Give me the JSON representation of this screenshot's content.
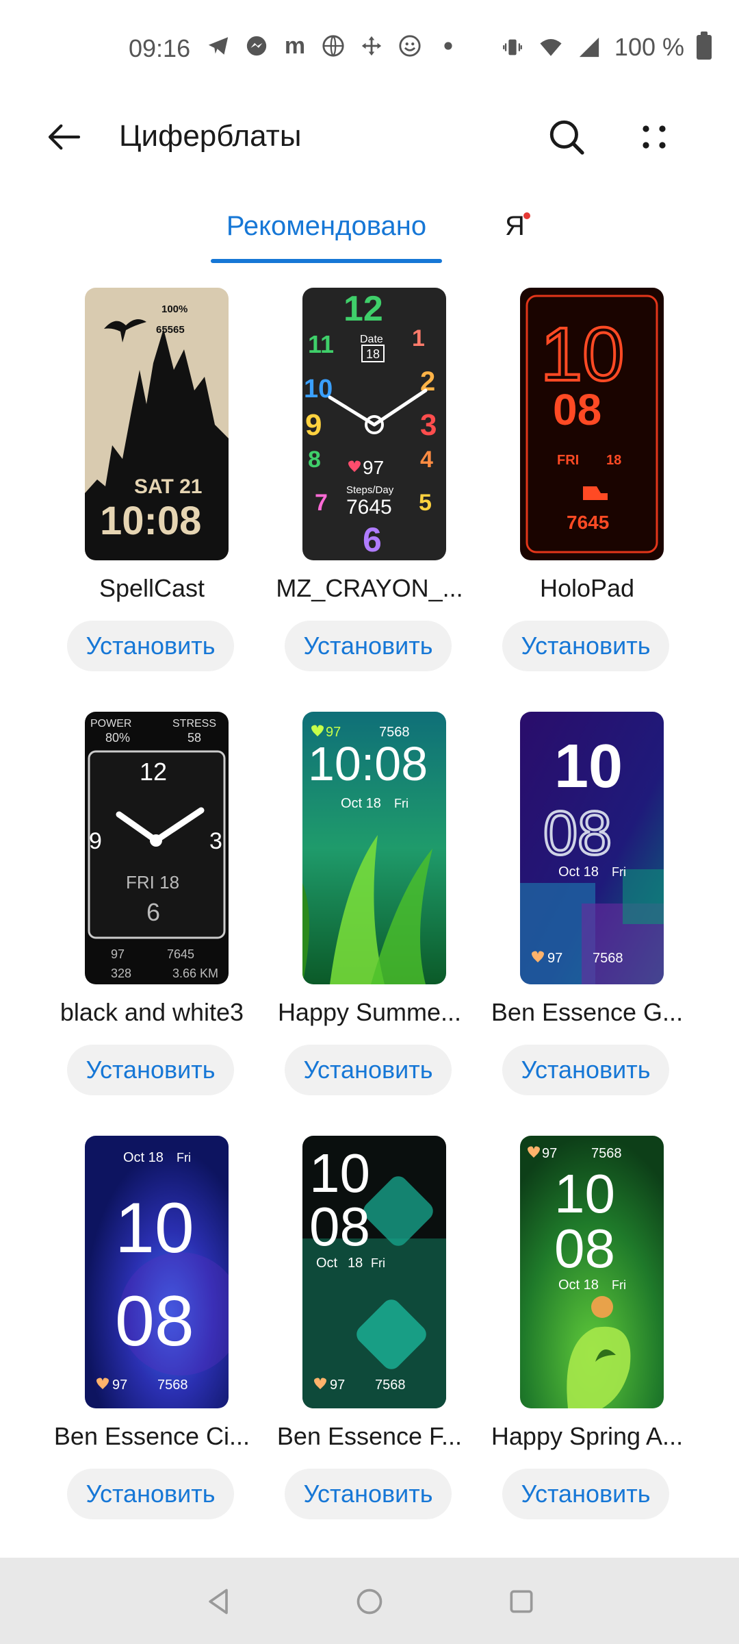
{
  "status_bar": {
    "time": "09:16",
    "battery": "100 %",
    "icons": [
      "telegram-icon",
      "messenger-icon",
      "m-icon",
      "globe-icon",
      "move-icon",
      "emoji-icon",
      "dot-icon"
    ]
  },
  "app_bar": {
    "title": "Циферблаты"
  },
  "tabs": {
    "recommended": "Рекомендовано",
    "me": "Я"
  },
  "accent_color": "#1677d6",
  "install_label": "Установить",
  "faces": [
    {
      "name": "SpellCast",
      "texts": [
        "100%",
        "65565",
        "SAT 21",
        "10:08"
      ]
    },
    {
      "name": "MZ_CRAYON_...",
      "texts": [
        "12",
        "Date",
        "18",
        "11",
        "1",
        "10",
        "2",
        "9",
        "3",
        "8",
        "4",
        "97",
        "Steps/Day",
        "7645",
        "7",
        "5",
        "6"
      ]
    },
    {
      "name": "HoloPad",
      "texts": [
        "10",
        "08",
        "FRI",
        "18",
        "7645"
      ]
    },
    {
      "name": "black and white3",
      "texts": [
        "POWER",
        "STRESS",
        "80%",
        "58",
        "12",
        "9",
        "3",
        "FRI 18",
        "6",
        "97",
        "7645",
        "328",
        "3.66 KM"
      ]
    },
    {
      "name": "Happy Summe...",
      "texts": [
        "97",
        "7568",
        "10:08",
        "Oct 18",
        "Fri"
      ]
    },
    {
      "name": "Ben Essence G...",
      "texts": [
        "10",
        "08",
        "Oct 18",
        "Fri",
        "97",
        "7568"
      ]
    },
    {
      "name": "Ben Essence Ci...",
      "texts": [
        "Oct 18",
        "Fri",
        "10",
        "08",
        "97",
        "7568"
      ]
    },
    {
      "name": "Ben Essence F...",
      "texts": [
        "10",
        "08",
        "Oct",
        "18",
        "Fri",
        "97",
        "7568"
      ]
    },
    {
      "name": "Happy Spring A...",
      "texts": [
        "97",
        "7568",
        "10",
        "08",
        "Oct 18",
        "Fri"
      ]
    }
  ]
}
